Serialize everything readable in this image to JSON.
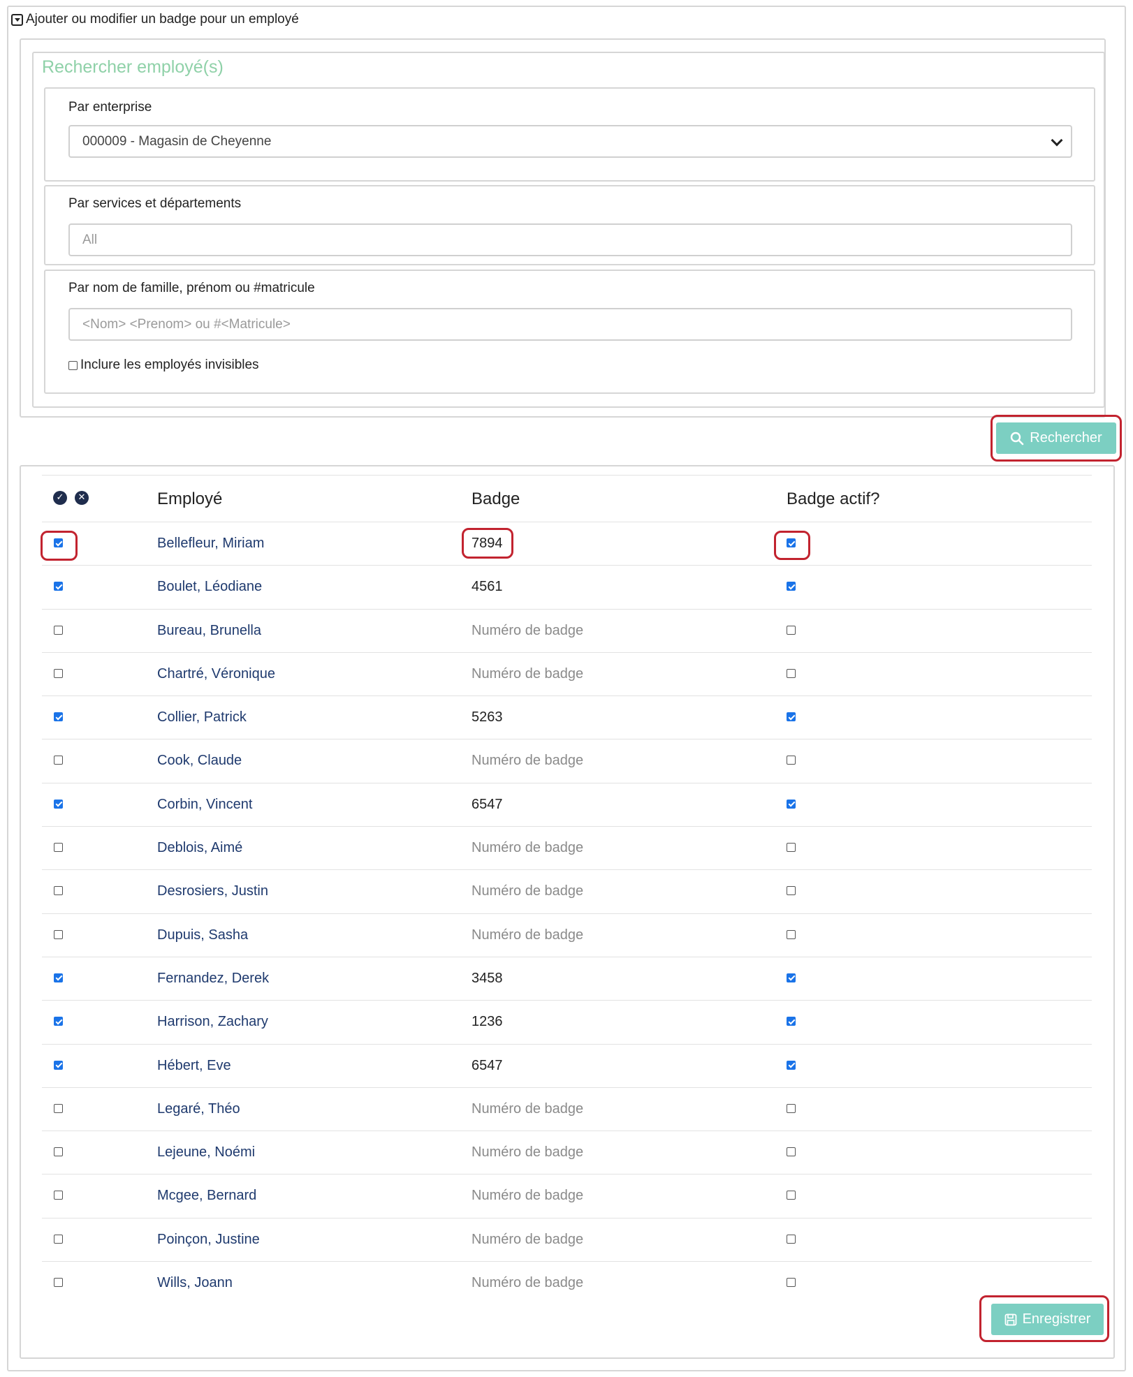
{
  "section_header": "Ajouter ou modifier un badge pour un employé",
  "search": {
    "title": "Rechercher employé(s)",
    "company_label": "Par enterprise",
    "company_value": "000009 - Magasin de Cheyenne",
    "department_label": "Par services et départements",
    "department_placeholder": "All",
    "name_label": "Par nom de famille, prénom ou #matricule",
    "name_placeholder": "<Nom> <Prenom> ou #<Matricule>",
    "invisible_label": "Inclure les employés invisibles",
    "invisible_checked": false,
    "search_button": "Rechercher"
  },
  "table": {
    "headers": [
      "Employé",
      "Badge",
      "Badge actif?"
    ],
    "badge_placeholder": "Numéro de badge",
    "rows": [
      {
        "selected": true,
        "name": "Bellefleur, Miriam",
        "badge": "7894",
        "active": true
      },
      {
        "selected": true,
        "name": "Boulet, Léodiane",
        "badge": "4561",
        "active": true
      },
      {
        "selected": false,
        "name": "Bureau, Brunella",
        "badge": "",
        "active": false
      },
      {
        "selected": false,
        "name": "Chartré, Véronique",
        "badge": "",
        "active": false
      },
      {
        "selected": true,
        "name": "Collier, Patrick",
        "badge": "5263",
        "active": true
      },
      {
        "selected": false,
        "name": "Cook, Claude",
        "badge": "",
        "active": false
      },
      {
        "selected": true,
        "name": "Corbin, Vincent",
        "badge": "6547",
        "active": true
      },
      {
        "selected": false,
        "name": "Deblois, Aimé",
        "badge": "",
        "active": false
      },
      {
        "selected": false,
        "name": "Desrosiers, Justin",
        "badge": "",
        "active": false
      },
      {
        "selected": false,
        "name": "Dupuis, Sasha",
        "badge": "",
        "active": false
      },
      {
        "selected": true,
        "name": "Fernandez, Derek",
        "badge": "3458",
        "active": true
      },
      {
        "selected": true,
        "name": "Harrison, Zachary",
        "badge": "1236",
        "active": true
      },
      {
        "selected": true,
        "name": "Hébert, Eve",
        "badge": "6547",
        "active": true
      },
      {
        "selected": false,
        "name": "Legaré, Théo",
        "badge": "",
        "active": false
      },
      {
        "selected": false,
        "name": "Lejeune, Noémi",
        "badge": "",
        "active": false
      },
      {
        "selected": false,
        "name": "Mcgee, Bernard",
        "badge": "",
        "active": false
      },
      {
        "selected": false,
        "name": "Poinçon, Justine",
        "badge": "",
        "active": false
      },
      {
        "selected": false,
        "name": "Wills, Joann",
        "badge": "",
        "active": false
      }
    ]
  },
  "save_button": "Enregistrer",
  "accent_color": "#7ccfc2",
  "highlight_color": "#c2232f"
}
